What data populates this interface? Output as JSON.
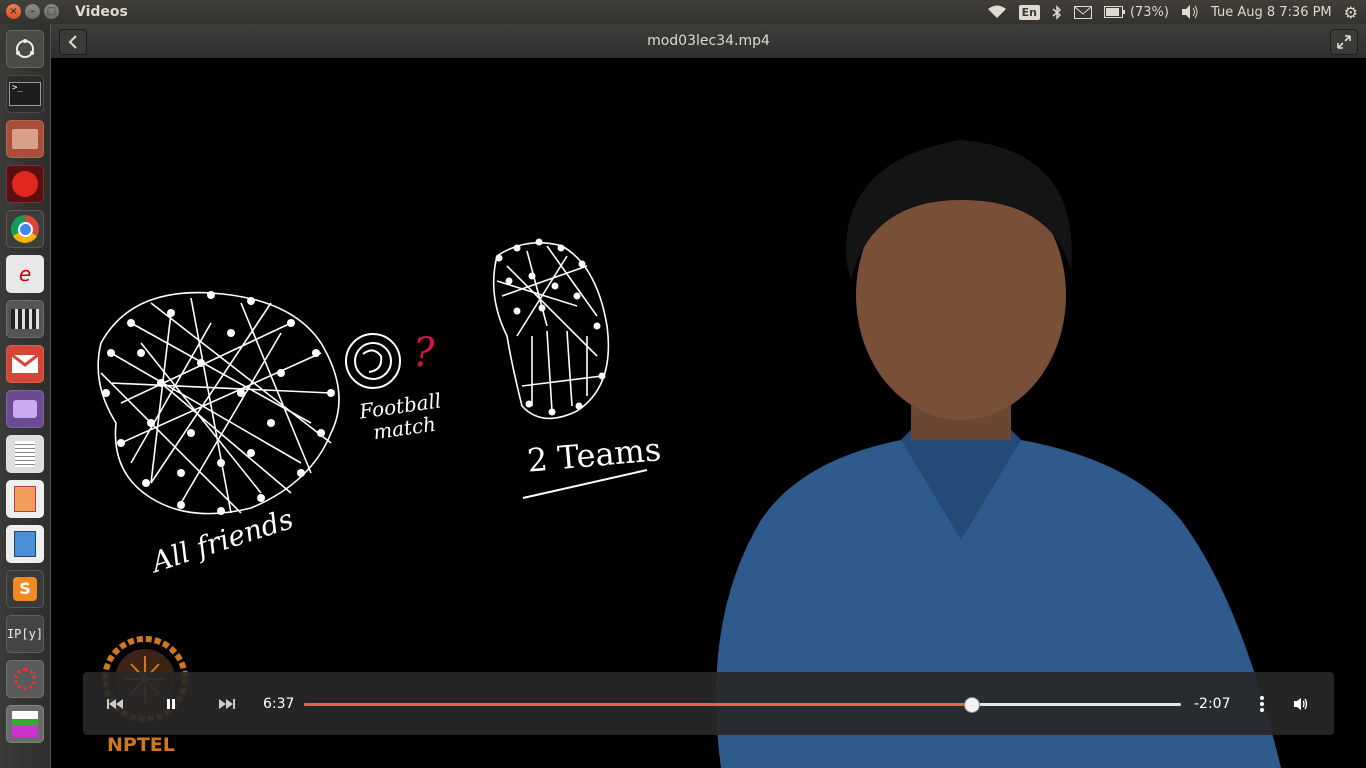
{
  "window": {
    "app_title": "Videos"
  },
  "indicators": {
    "keyboard": "En",
    "battery": "(73%)",
    "clock": "Tue Aug  8  7:36 PM"
  },
  "header": {
    "file_title": "mod03lec34.mp4"
  },
  "launcher": {
    "items": [
      "ubuntu-dash-icon",
      "terminal-icon",
      "file-manager-icon",
      "opera-icon",
      "chrome-icon",
      "evince-icon",
      "video-editor-icon",
      "gmail-icon",
      "screenshot-icon",
      "text-editor-icon",
      "impress-icon",
      "writer-icon",
      "sublime-icon",
      "ipython-icon",
      "settings-icon",
      "app-icon"
    ]
  },
  "video": {
    "annotations": {
      "all_friends": "All friends",
      "football": "Football",
      "match": "match",
      "question": "?",
      "two_teams": "2 Teams"
    },
    "logo_text": "NPTEL"
  },
  "player": {
    "elapsed": "6:37",
    "remaining": "-2:07",
    "progress": 0.76
  },
  "colors": {
    "accent": "#e9683b",
    "panel": "#3c3b37"
  }
}
